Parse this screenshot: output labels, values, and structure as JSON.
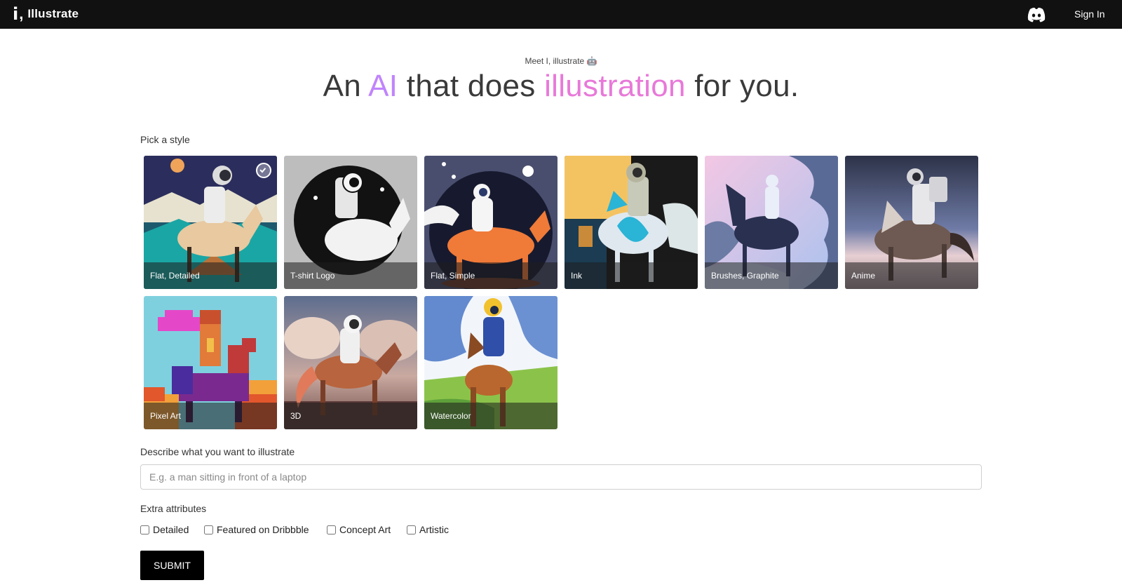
{
  "nav": {
    "logo_mark": "i",
    "logo_comma": ",",
    "logo_text": "Illustrate",
    "discord_icon": "discord-icon",
    "signin_label": "Sign In"
  },
  "hero": {
    "kicker": "Meet I, illustrate 🤖",
    "headline_1": "An ",
    "headline_ai": "AI",
    "headline_2": " that does ",
    "headline_ill": "illustration",
    "headline_3": " for you."
  },
  "styles": {
    "label": "Pick a style",
    "selected": "Flat, Detailed",
    "items": [
      {
        "label": "Flat, Detailed"
      },
      {
        "label": "T-shirt Logo"
      },
      {
        "label": "Flat, Simple"
      },
      {
        "label": "Ink"
      },
      {
        "label": "Brushes, Graphite"
      },
      {
        "label": "Anime"
      },
      {
        "label": "Pixel Art"
      },
      {
        "label": "3D"
      },
      {
        "label": "Watercolor"
      }
    ]
  },
  "describe": {
    "label": "Describe what you want to illustrate",
    "value": "",
    "placeholder": "E.g. a man sitting in front of a laptop"
  },
  "extras": {
    "label": "Extra attributes",
    "options": [
      {
        "label": "Detailed",
        "checked": false
      },
      {
        "label": "Featured on Dribbble",
        "checked": false
      },
      {
        "label": "Concept Art",
        "checked": false
      },
      {
        "label": "Artistic",
        "checked": false
      }
    ]
  },
  "submit_label": "SUBMIT",
  "colors": {
    "navbar": "#111111",
    "accent_ai": "#c084fc",
    "accent_illustration": "#e879d9",
    "submit": "#000000"
  }
}
